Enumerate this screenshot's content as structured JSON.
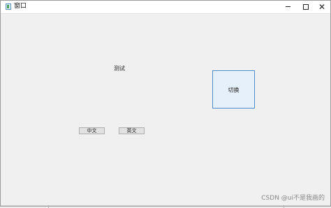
{
  "window": {
    "title": "窗口",
    "minimize": "–",
    "maximize": "□",
    "close": "✕"
  },
  "main": {
    "label": "测试",
    "switch_button": "切换",
    "buttons": [
      "中文",
      "英文"
    ]
  },
  "watermark": "CSDN @ui不是我画的",
  "colors": {
    "background": "#f0f0f0",
    "accent_border": "#4f8ecb",
    "accent_fill": "#e5f0fb"
  }
}
